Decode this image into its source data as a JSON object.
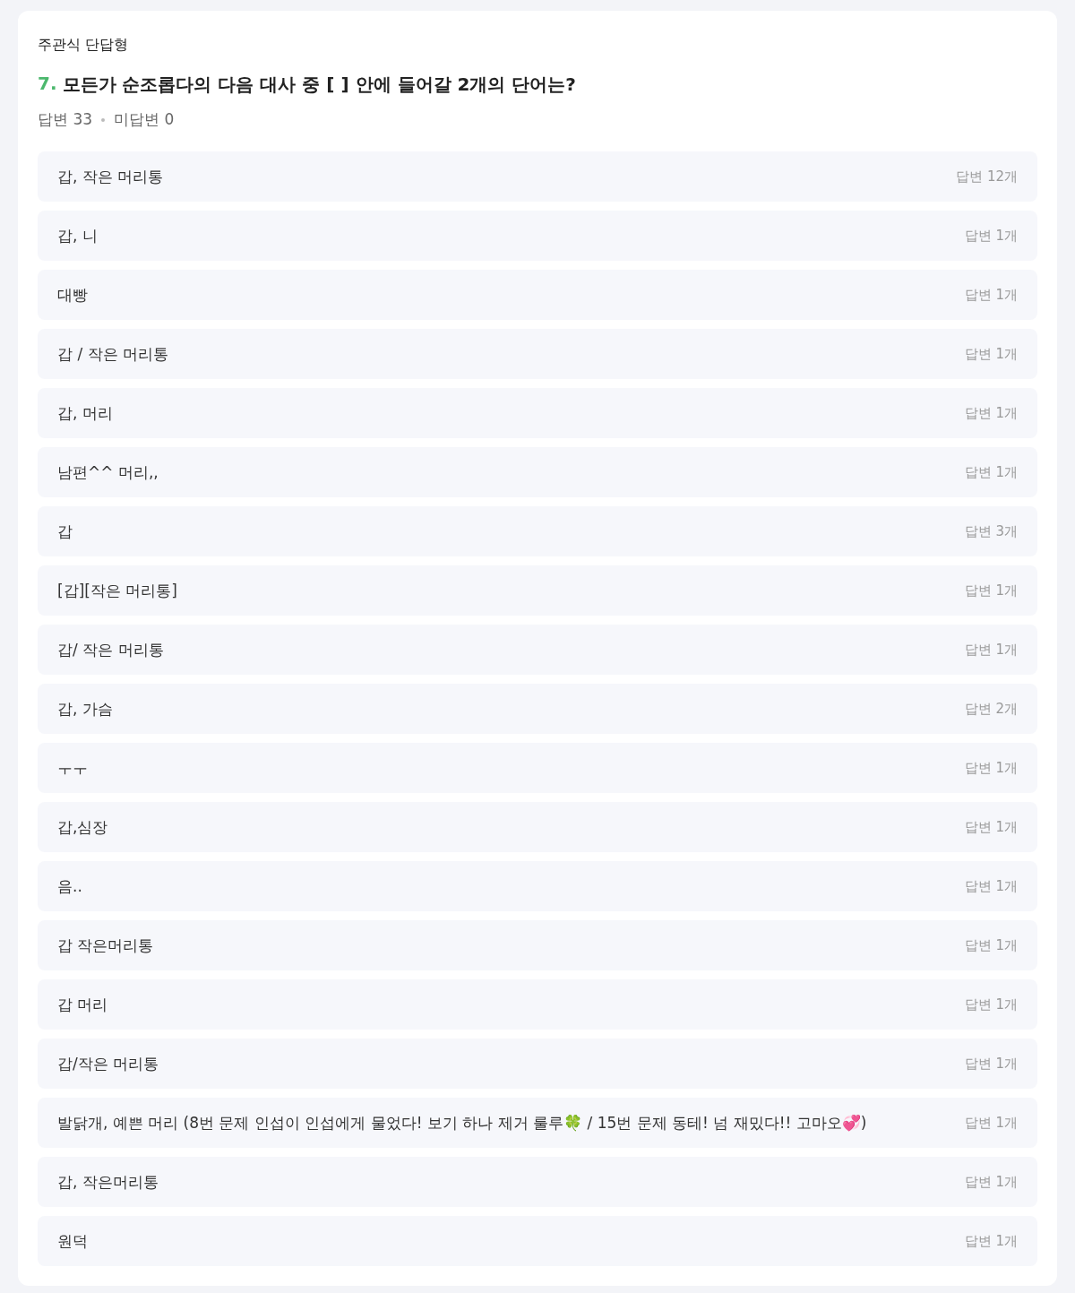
{
  "question": {
    "type": "주관식 단답형",
    "number": "7.",
    "title": "모든가 순조롭다의 다음 대사 중 [ ] 안에 들어갈 2개의 단어는?",
    "answered": "답변 33",
    "unanswered": "미답변 0"
  },
  "answers": [
    {
      "text": "갑, 작은 머리통",
      "count": "답변 12개"
    },
    {
      "text": "갑, 니",
      "count": "답변 1개"
    },
    {
      "text": "대빵",
      "count": "답변 1개"
    },
    {
      "text": "갑 / 작은 머리통",
      "count": "답변 1개"
    },
    {
      "text": "갑, 머리",
      "count": "답변 1개"
    },
    {
      "text": "남편^^ 머리,,",
      "count": "답변 1개"
    },
    {
      "text": "갑",
      "count": "답변 3개"
    },
    {
      "text": "[갑][작은 머리통]",
      "count": "답변 1개"
    },
    {
      "text": "갑/ 작은 머리통",
      "count": "답변 1개"
    },
    {
      "text": "갑, 가슴",
      "count": "답변 2개"
    },
    {
      "text": "ㅜㅜ",
      "count": "답변 1개"
    },
    {
      "text": "갑,심장",
      "count": "답변 1개"
    },
    {
      "text": "음..",
      "count": "답변 1개"
    },
    {
      "text": "갑 작은머리통",
      "count": "답변 1개"
    },
    {
      "text": "갑 머리",
      "count": "답변 1개"
    },
    {
      "text": "갑/작은 머리통",
      "count": "답변 1개"
    },
    {
      "text": "발닭개, 예쁜 머리 (8번 문제 인섭이 인섭에게 물었다! 보기 하나 제거 룰루🍀 / 15번 문제 동테! 넘 재밌다!! 고마오💞)",
      "count": "답변 1개"
    },
    {
      "text": "갑, 작은머리통",
      "count": "답변 1개"
    },
    {
      "text": "원덕",
      "count": "답변 1개"
    }
  ]
}
